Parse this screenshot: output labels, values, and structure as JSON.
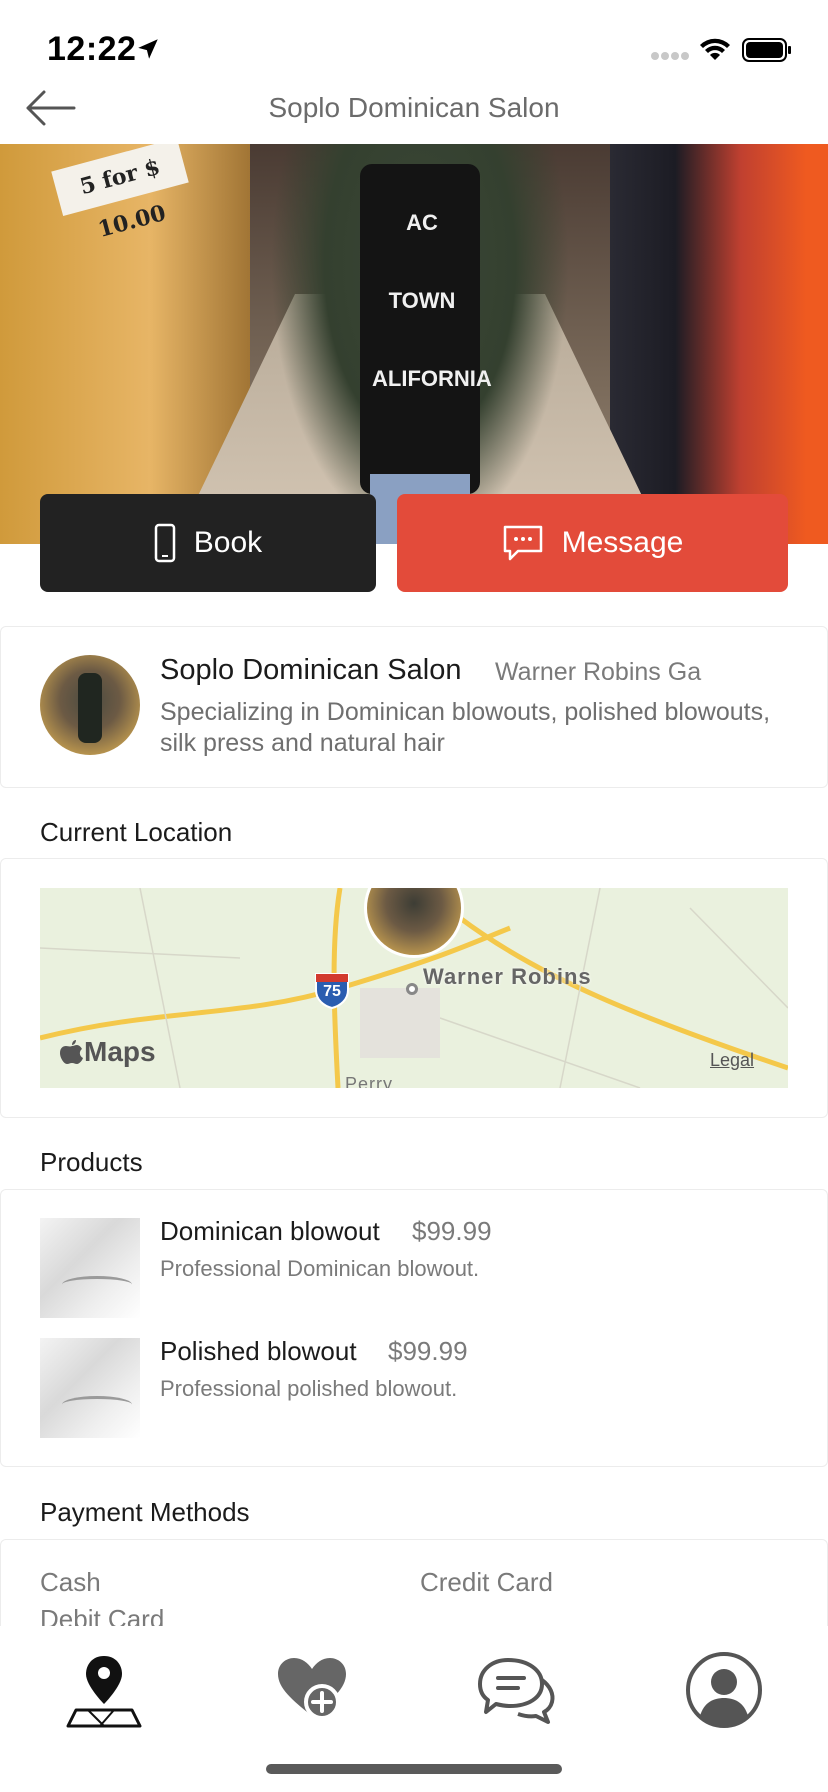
{
  "status_bar": {
    "time": "12:22"
  },
  "nav": {
    "title": "Soplo Dominican Salon"
  },
  "hero": {
    "sign_text": "5 for $ 10.00",
    "shirt_text": "AC TOWN\nALIFORNIA"
  },
  "actions": {
    "book_label": "Book",
    "message_label": "Message"
  },
  "salon": {
    "name": "Soplo Dominican Salon",
    "city": "Warner Robins Ga",
    "description": "Specializing in Dominican blowouts, polished blowouts, silk press and natural hair"
  },
  "location": {
    "section_title": "Current Location",
    "map_city": "Warner Robins",
    "map_logo": "Maps",
    "map_legal": "Legal",
    "map_town2": "Perry",
    "interstate": "75"
  },
  "products": {
    "section_title": "Products",
    "items": [
      {
        "name": "Dominican blowout",
        "price": "$99.99",
        "description": "Professional Dominican blowout."
      },
      {
        "name": "Polished blowout",
        "price": "$99.99",
        "description": "Professional polished blowout."
      }
    ]
  },
  "payments": {
    "section_title": "Payment Methods",
    "methods": [
      "Cash",
      "Credit Card",
      "Debit Card"
    ]
  },
  "tabbar": {
    "items": [
      {
        "icon": "map-pin-icon",
        "active": true
      },
      {
        "icon": "heart-plus-icon",
        "active": false
      },
      {
        "icon": "chat-bubbles-icon",
        "active": false
      },
      {
        "icon": "profile-icon",
        "active": false
      }
    ]
  },
  "colors": {
    "book": "#222222",
    "message": "#e34b3a",
    "text": "#1b1b1b",
    "muted": "#7a7a7a"
  }
}
